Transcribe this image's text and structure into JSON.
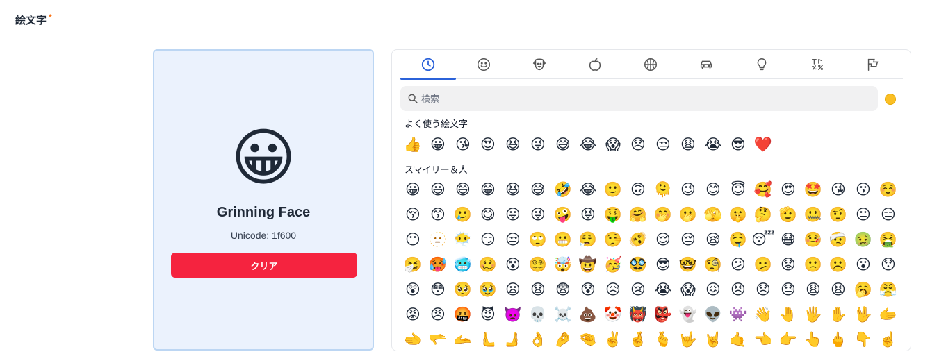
{
  "field": {
    "label": "絵文字",
    "required_mark": "*"
  },
  "preview": {
    "emoji": "😀",
    "name": "Grinning Face",
    "unicode": "Unicode: 1f600",
    "clear_label": "クリア"
  },
  "picker": {
    "tabs": [
      {
        "icon": "clock-icon",
        "active": true
      },
      {
        "icon": "smiley-icon"
      },
      {
        "icon": "animal-icon"
      },
      {
        "icon": "apple-icon"
      },
      {
        "icon": "basketball-icon"
      },
      {
        "icon": "car-icon"
      },
      {
        "icon": "lightbulb-icon"
      },
      {
        "icon": "symbols-icon"
      },
      {
        "icon": "flag-icon"
      }
    ],
    "search_placeholder": "検索",
    "skin_tone_color": "#fbbf24",
    "accent_color": "#2b62d9",
    "sections": [
      {
        "title": "よく使う絵文字",
        "rows": [
          [
            "👍",
            "😀",
            "😘",
            "😍",
            "😆",
            "😜",
            "😅",
            "😂",
            "😱",
            "😞",
            "😒",
            "😩",
            "😭",
            "😎",
            "❤️"
          ]
        ]
      },
      {
        "title": "スマイリー＆人",
        "rows": [
          [
            "😀",
            "😃",
            "😄",
            "😁",
            "😆",
            "😅",
            "🤣",
            "😂",
            "🙂",
            "🙃",
            "🫠",
            "😉",
            "😊",
            "😇",
            "🥰",
            "😍",
            "🤩",
            "😘",
            "😗",
            "☺️"
          ],
          [
            "😚",
            "😙",
            "🥲",
            "😋",
            "😛",
            "😜",
            "🤪",
            "😝",
            "🤑",
            "🤗",
            "🤭",
            "🫢",
            "🫣",
            "🤫",
            "🤔",
            "🫡",
            "🤐",
            "🤨",
            "😐",
            "😑"
          ],
          [
            "😶",
            "🫥",
            "😶‍🌫️",
            "😏",
            "😒",
            "🙄",
            "😬",
            "😮‍💨",
            "🤥",
            "🫨",
            "😌",
            "😔",
            "😪",
            "🤤",
            "😴",
            "😷",
            "🤒",
            "🤕",
            "🤢",
            "🤮"
          ],
          [
            "🤧",
            "🥵",
            "🥶",
            "🥴",
            "😵",
            "😵‍💫",
            "🤯",
            "🤠",
            "🥳",
            "🥸",
            "😎",
            "🤓",
            "🧐",
            "😕",
            "🫤",
            "😟",
            "🙁",
            "☹️",
            "😮",
            "😯"
          ],
          [
            "😲",
            "😳",
            "🥺",
            "🥹",
            "😦",
            "😧",
            "😨",
            "😰",
            "😥",
            "😢",
            "😭",
            "😱",
            "😖",
            "😣",
            "😞",
            "😓",
            "😩",
            "😫",
            "🥱",
            "😤"
          ],
          [
            "😡",
            "😠",
            "🤬",
            "😈",
            "👿",
            "💀",
            "☠️",
            "💩",
            "🤡",
            "👹",
            "👺",
            "👻",
            "👽",
            "👾",
            "👋",
            "🤚",
            "🖐️",
            "✋",
            "🖖",
            "🫱"
          ],
          [
            "🫲",
            "🫳",
            "🫴",
            "🫷",
            "🫸",
            "👌",
            "🤌",
            "🤏",
            "✌️",
            "🤞",
            "🫰",
            "🤟",
            "🤘",
            "🤙",
            "👈",
            "👉",
            "👆",
            "🖕",
            "👇",
            "☝️"
          ]
        ]
      }
    ]
  }
}
